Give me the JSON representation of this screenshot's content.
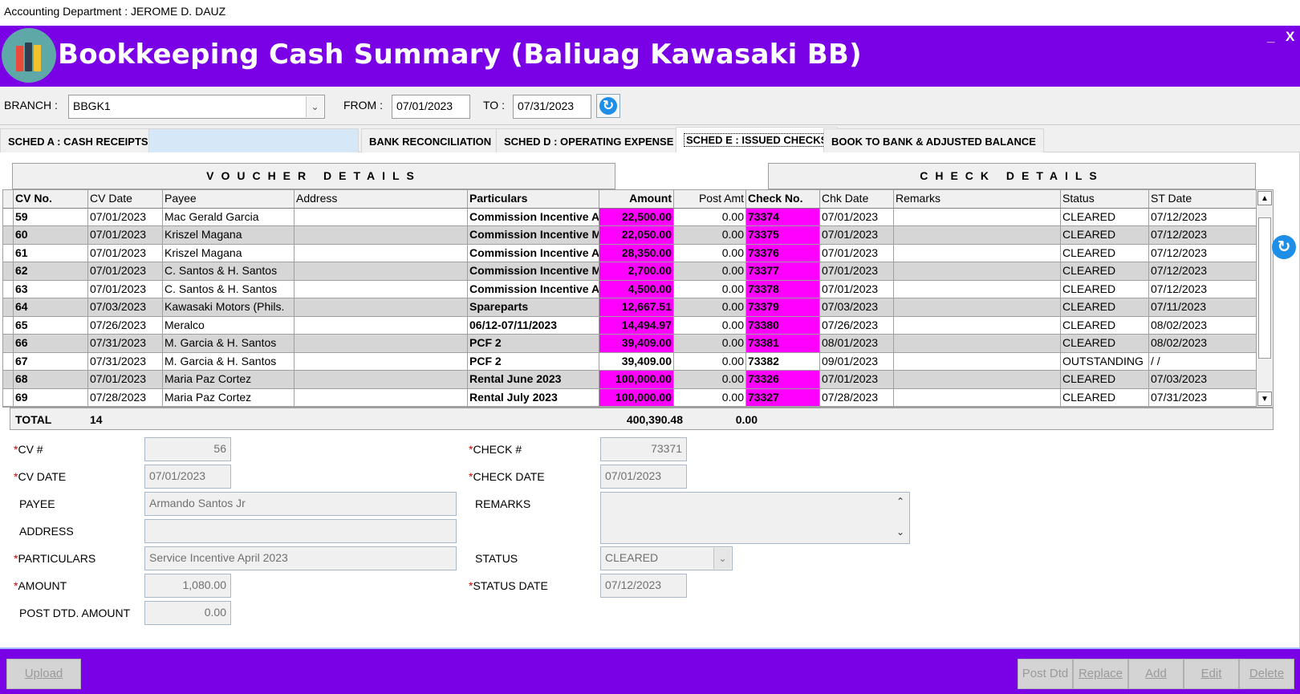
{
  "window": {
    "title": "Accounting Department : JEROME D. DAUZ",
    "minimize": "_",
    "close": "X"
  },
  "header": {
    "title": "Bookkeeping Cash Summary (Baliuag Kawasaki BB)",
    "logo_icon": "books-icon"
  },
  "toolbar": {
    "branch_label": "BRANCH :",
    "branch_value": "BBGK1",
    "from_label": "FROM :",
    "from_value": "07/01/2023",
    "to_label": "TO :",
    "to_value": "07/31/2023"
  },
  "tabs": [
    {
      "label": "SCHED A : CASH RECEIPTS",
      "active": false
    },
    {
      "label": "BANK RECONCILIATION",
      "active": false
    },
    {
      "label": "SCHED D : OPERATING EXPENSE",
      "active": false
    },
    {
      "label": "SCHED E : ISSUED CHECKS",
      "active": true
    },
    {
      "label": "BOOK TO BANK & ADJUSTED BALANCE",
      "active": false
    }
  ],
  "grid": {
    "voucher_header": "VOUCHER DETAILS",
    "check_header": "CHECK DETAILS",
    "columns": [
      "CV No.",
      "CV Date",
      "Payee",
      "Address",
      "Particulars",
      "Amount",
      "Post Amt",
      "Check No.",
      "Chk Date",
      "Remarks",
      "Status",
      "ST Date"
    ],
    "rows": [
      {
        "cv_no": "59",
        "cv_date": "07/01/2023",
        "payee": "Mac Gerald Garcia",
        "address": "",
        "particulars": "Commission Incentive April",
        "amount": "22,500.00",
        "post_amt": "0.00",
        "check_no": "73374",
        "chk_date": "07/01/2023",
        "remarks": "",
        "status": "CLEARED",
        "st_date": "07/12/2023",
        "highlight": true
      },
      {
        "cv_no": "60",
        "cv_date": "07/01/2023",
        "payee": "Kriszel Magana",
        "address": "",
        "particulars": "Commission Incentive May",
        "amount": "22,050.00",
        "post_amt": "0.00",
        "check_no": "73375",
        "chk_date": "07/01/2023",
        "remarks": "",
        "status": "CLEARED",
        "st_date": "07/12/2023",
        "highlight": true
      },
      {
        "cv_no": "61",
        "cv_date": "07/01/2023",
        "payee": "Kriszel Magana",
        "address": "",
        "particulars": "Commission Incentive April",
        "amount": "28,350.00",
        "post_amt": "0.00",
        "check_no": "73376",
        "chk_date": "07/01/2023",
        "remarks": "",
        "status": "CLEARED",
        "st_date": "07/12/2023",
        "highlight": true
      },
      {
        "cv_no": "62",
        "cv_date": "07/01/2023",
        "payee": "C. Santos & H. Santos",
        "address": "",
        "particulars": "Commission Incentive May",
        "amount": "2,700.00",
        "post_amt": "0.00",
        "check_no": "73377",
        "chk_date": "07/01/2023",
        "remarks": "",
        "status": "CLEARED",
        "st_date": "07/12/2023",
        "highlight": true
      },
      {
        "cv_no": "63",
        "cv_date": "07/01/2023",
        "payee": "C. Santos & H. Santos",
        "address": "",
        "particulars": "Commission Incentive April",
        "amount": "4,500.00",
        "post_amt": "0.00",
        "check_no": "73378",
        "chk_date": "07/01/2023",
        "remarks": "",
        "status": "CLEARED",
        "st_date": "07/12/2023",
        "highlight": true
      },
      {
        "cv_no": "64",
        "cv_date": "07/03/2023",
        "payee": "Kawasaki Motors (Phils.",
        "address": "",
        "particulars": "Spareparts",
        "amount": "12,667.51",
        "post_amt": "0.00",
        "check_no": "73379",
        "chk_date": "07/03/2023",
        "remarks": "",
        "status": "CLEARED",
        "st_date": "07/11/2023",
        "highlight": true
      },
      {
        "cv_no": "65",
        "cv_date": "07/26/2023",
        "payee": "Meralco",
        "address": "",
        "particulars": "06/12-07/11/2023",
        "amount": "14,494.97",
        "post_amt": "0.00",
        "check_no": "73380",
        "chk_date": "07/26/2023",
        "remarks": "",
        "status": "CLEARED",
        "st_date": "08/02/2023",
        "highlight": true
      },
      {
        "cv_no": "66",
        "cv_date": "07/31/2023",
        "payee": "M. Garcia & H. Santos",
        "address": "",
        "particulars": "PCF 2",
        "amount": "39,409.00",
        "post_amt": "0.00",
        "check_no": "73381",
        "chk_date": "08/01/2023",
        "remarks": "",
        "status": "CLEARED",
        "st_date": "08/02/2023",
        "highlight": true
      },
      {
        "cv_no": "67",
        "cv_date": "07/31/2023",
        "payee": "M. Garcia & H. Santos",
        "address": "",
        "particulars": "PCF 2",
        "amount": "39,409.00",
        "post_amt": "0.00",
        "check_no": "73382",
        "chk_date": "09/01/2023",
        "remarks": "",
        "status": "OUTSTANDING",
        "st_date": "/ /",
        "highlight": false
      },
      {
        "cv_no": "68",
        "cv_date": "07/01/2023",
        "payee": "Maria Paz Cortez",
        "address": "",
        "particulars": "Rental June  2023",
        "amount": "100,000.00",
        "post_amt": "0.00",
        "check_no": "73326",
        "chk_date": "07/01/2023",
        "remarks": "",
        "status": "CLEARED",
        "st_date": "07/03/2023",
        "highlight": true
      },
      {
        "cv_no": "69",
        "cv_date": "07/28/2023",
        "payee": "Maria Paz Cortez",
        "address": "",
        "particulars": "Rental July 2023",
        "amount": "100,000.00",
        "post_amt": "0.00",
        "check_no": "73327",
        "chk_date": "07/28/2023",
        "remarks": "",
        "status": "CLEARED",
        "st_date": "07/31/2023",
        "highlight": true
      }
    ],
    "total_label": "TOTAL",
    "total_count": "14",
    "total_amount": "400,390.48",
    "total_post_amt": "0.00"
  },
  "form": {
    "cv_label": "CV #",
    "cv_value": "56",
    "cv_date_label": "CV DATE",
    "cv_date_value": "07/01/2023",
    "payee_label": "PAYEE",
    "payee_value": "Armando Santos Jr",
    "address_label": "ADDRESS",
    "address_value": "",
    "particulars_label": "PARTICULARS",
    "particulars_value": "Service Incentive April 2023",
    "amount_label": "AMOUNT",
    "amount_value": "1,080.00",
    "post_dtd_label": "POST DTD. AMOUNT",
    "post_dtd_value": "0.00",
    "check_label": "CHECK #",
    "check_value": "73371",
    "check_date_label": "CHECK DATE",
    "check_date_value": "07/01/2023",
    "remarks_label": "REMARKS",
    "remarks_value": "",
    "status_label": "STATUS",
    "status_value": "CLEARED",
    "status_date_label": "STATUS DATE",
    "status_date_value": "07/12/2023",
    "required_mark": "*"
  },
  "footer": {
    "upload_label": "Upload",
    "post_dtd_label": "Post Dtd",
    "replace_label": "Replace",
    "add_label": "Add",
    "edit_label": "Edit",
    "delete_label": "Delete"
  },
  "colors": {
    "brand": "#7a00e6",
    "highlight": "#ff00ff",
    "refresh": "#1e8fe8"
  }
}
